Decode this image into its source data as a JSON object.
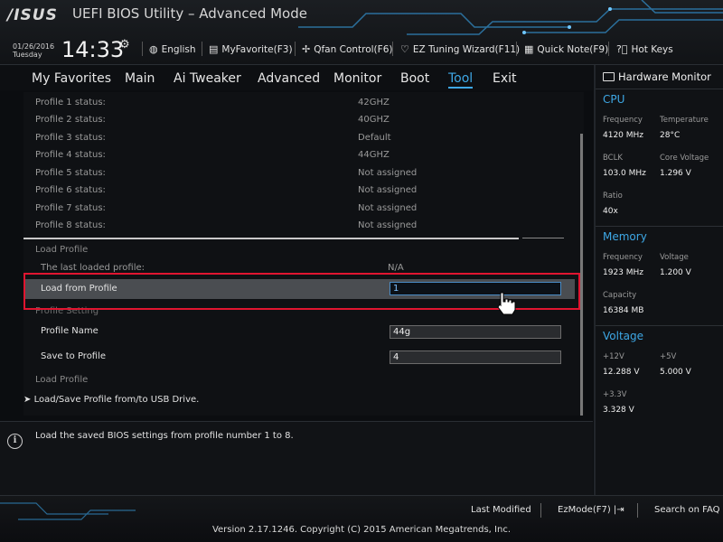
{
  "header": {
    "logo": "/ISUS",
    "title": "UEFI BIOS Utility – Advanced Mode",
    "date": "01/26/2016",
    "day": "Tuesday",
    "time": "14:33",
    "buttons": {
      "language": "English",
      "my_favorite": "MyFavorite(F3)",
      "qfan": "Qfan Control(F6)",
      "ez_tuning": "EZ Tuning Wizard(F11)",
      "quick_note": "Quick Note(F9)",
      "hot_keys": "Hot Keys"
    }
  },
  "nav": {
    "tabs": [
      "My Favorites",
      "Main",
      "Ai Tweaker",
      "Advanced",
      "Monitor",
      "Boot",
      "Tool",
      "Exit"
    ],
    "active": "Tool"
  },
  "profiles": [
    {
      "label": "Profile 1 status:",
      "value": "42GHZ"
    },
    {
      "label": "Profile 2 status:",
      "value": "40GHZ"
    },
    {
      "label": "Profile 3 status:",
      "value": "Default"
    },
    {
      "label": "Profile 4 status:",
      "value": "44GHZ"
    },
    {
      "label": "Profile 5 status:",
      "value": "Not assigned"
    },
    {
      "label": "Profile 6 status:",
      "value": "Not assigned"
    },
    {
      "label": "Profile 7 status:",
      "value": "Not assigned"
    },
    {
      "label": "Profile 8 status:",
      "value": "Not assigned"
    }
  ],
  "load_section": {
    "heading": "Load Profile",
    "last_loaded_label": "The last loaded profile:",
    "last_loaded_value": "N/A",
    "load_from_label": "Load from Profile",
    "load_from_value": "1"
  },
  "profile_setting": {
    "heading": "Profile Setting",
    "name_label": "Profile Name",
    "name_value": "44g",
    "save_label": "Save to Profile",
    "save_value": "4",
    "load_heading": "Load Profile"
  },
  "usb_link": "Load/Save Profile from/to USB Drive.",
  "help_text": "Load the saved BIOS settings from profile number 1 to 8.",
  "hw": {
    "title": "Hardware Monitor",
    "cpu": {
      "heading": "CPU",
      "frequency_label": "Frequency",
      "frequency": "4120 MHz",
      "temperature_label": "Temperature",
      "temperature": "28°C",
      "bclk_label": "BCLK",
      "bclk": "103.0 MHz",
      "core_voltage_label": "Core Voltage",
      "core_voltage": "1.296 V",
      "ratio_label": "Ratio",
      "ratio": "40x"
    },
    "memory": {
      "heading": "Memory",
      "frequency_label": "Frequency",
      "frequency": "1923 MHz",
      "voltage_label": "Voltage",
      "voltage": "1.200 V",
      "capacity_label": "Capacity",
      "capacity": "16384 MB"
    },
    "voltage": {
      "heading": "Voltage",
      "v12_label": "+12V",
      "v12": "12.288 V",
      "v5_label": "+5V",
      "v5": "5.000 V",
      "v33_label": "+3.3V",
      "v33": "3.328 V"
    }
  },
  "footer": {
    "last_modified": "Last Modified",
    "ez_mode": "EzMode(F7)",
    "search_faq": "Search on FAQ",
    "version": "Version 2.17.1246. Copyright (C) 2015 American Megatrends, Inc."
  },
  "colors": {
    "accent": "#3ea8e6",
    "highlight": "#e01530"
  }
}
